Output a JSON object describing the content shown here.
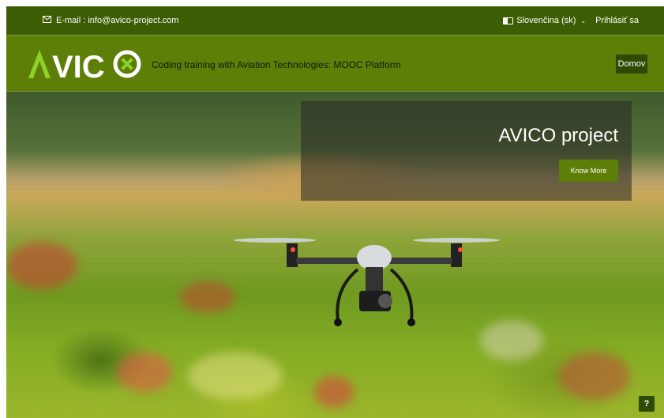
{
  "topbar": {
    "email_text": "E-mail : info@avico-project.com",
    "email_icon": "envelope-icon",
    "language_label": "Slovenčina (sk)",
    "language_icon": "language-flag-icon",
    "login_label": "Prihlásiť sa"
  },
  "header": {
    "logo_text": "AVICO",
    "tagline": "Coding training with Aviation Technologies: MOOC Platform",
    "nav_home": "Domov"
  },
  "hero": {
    "title": "AVICO project",
    "cta_label": "Know More",
    "help_label": "?"
  },
  "colors": {
    "topbar_bg": "#3d5d04",
    "header_bg": "#5e7f07",
    "button_dark": "#2f4a04",
    "logo_accent": "#8fd12a"
  }
}
